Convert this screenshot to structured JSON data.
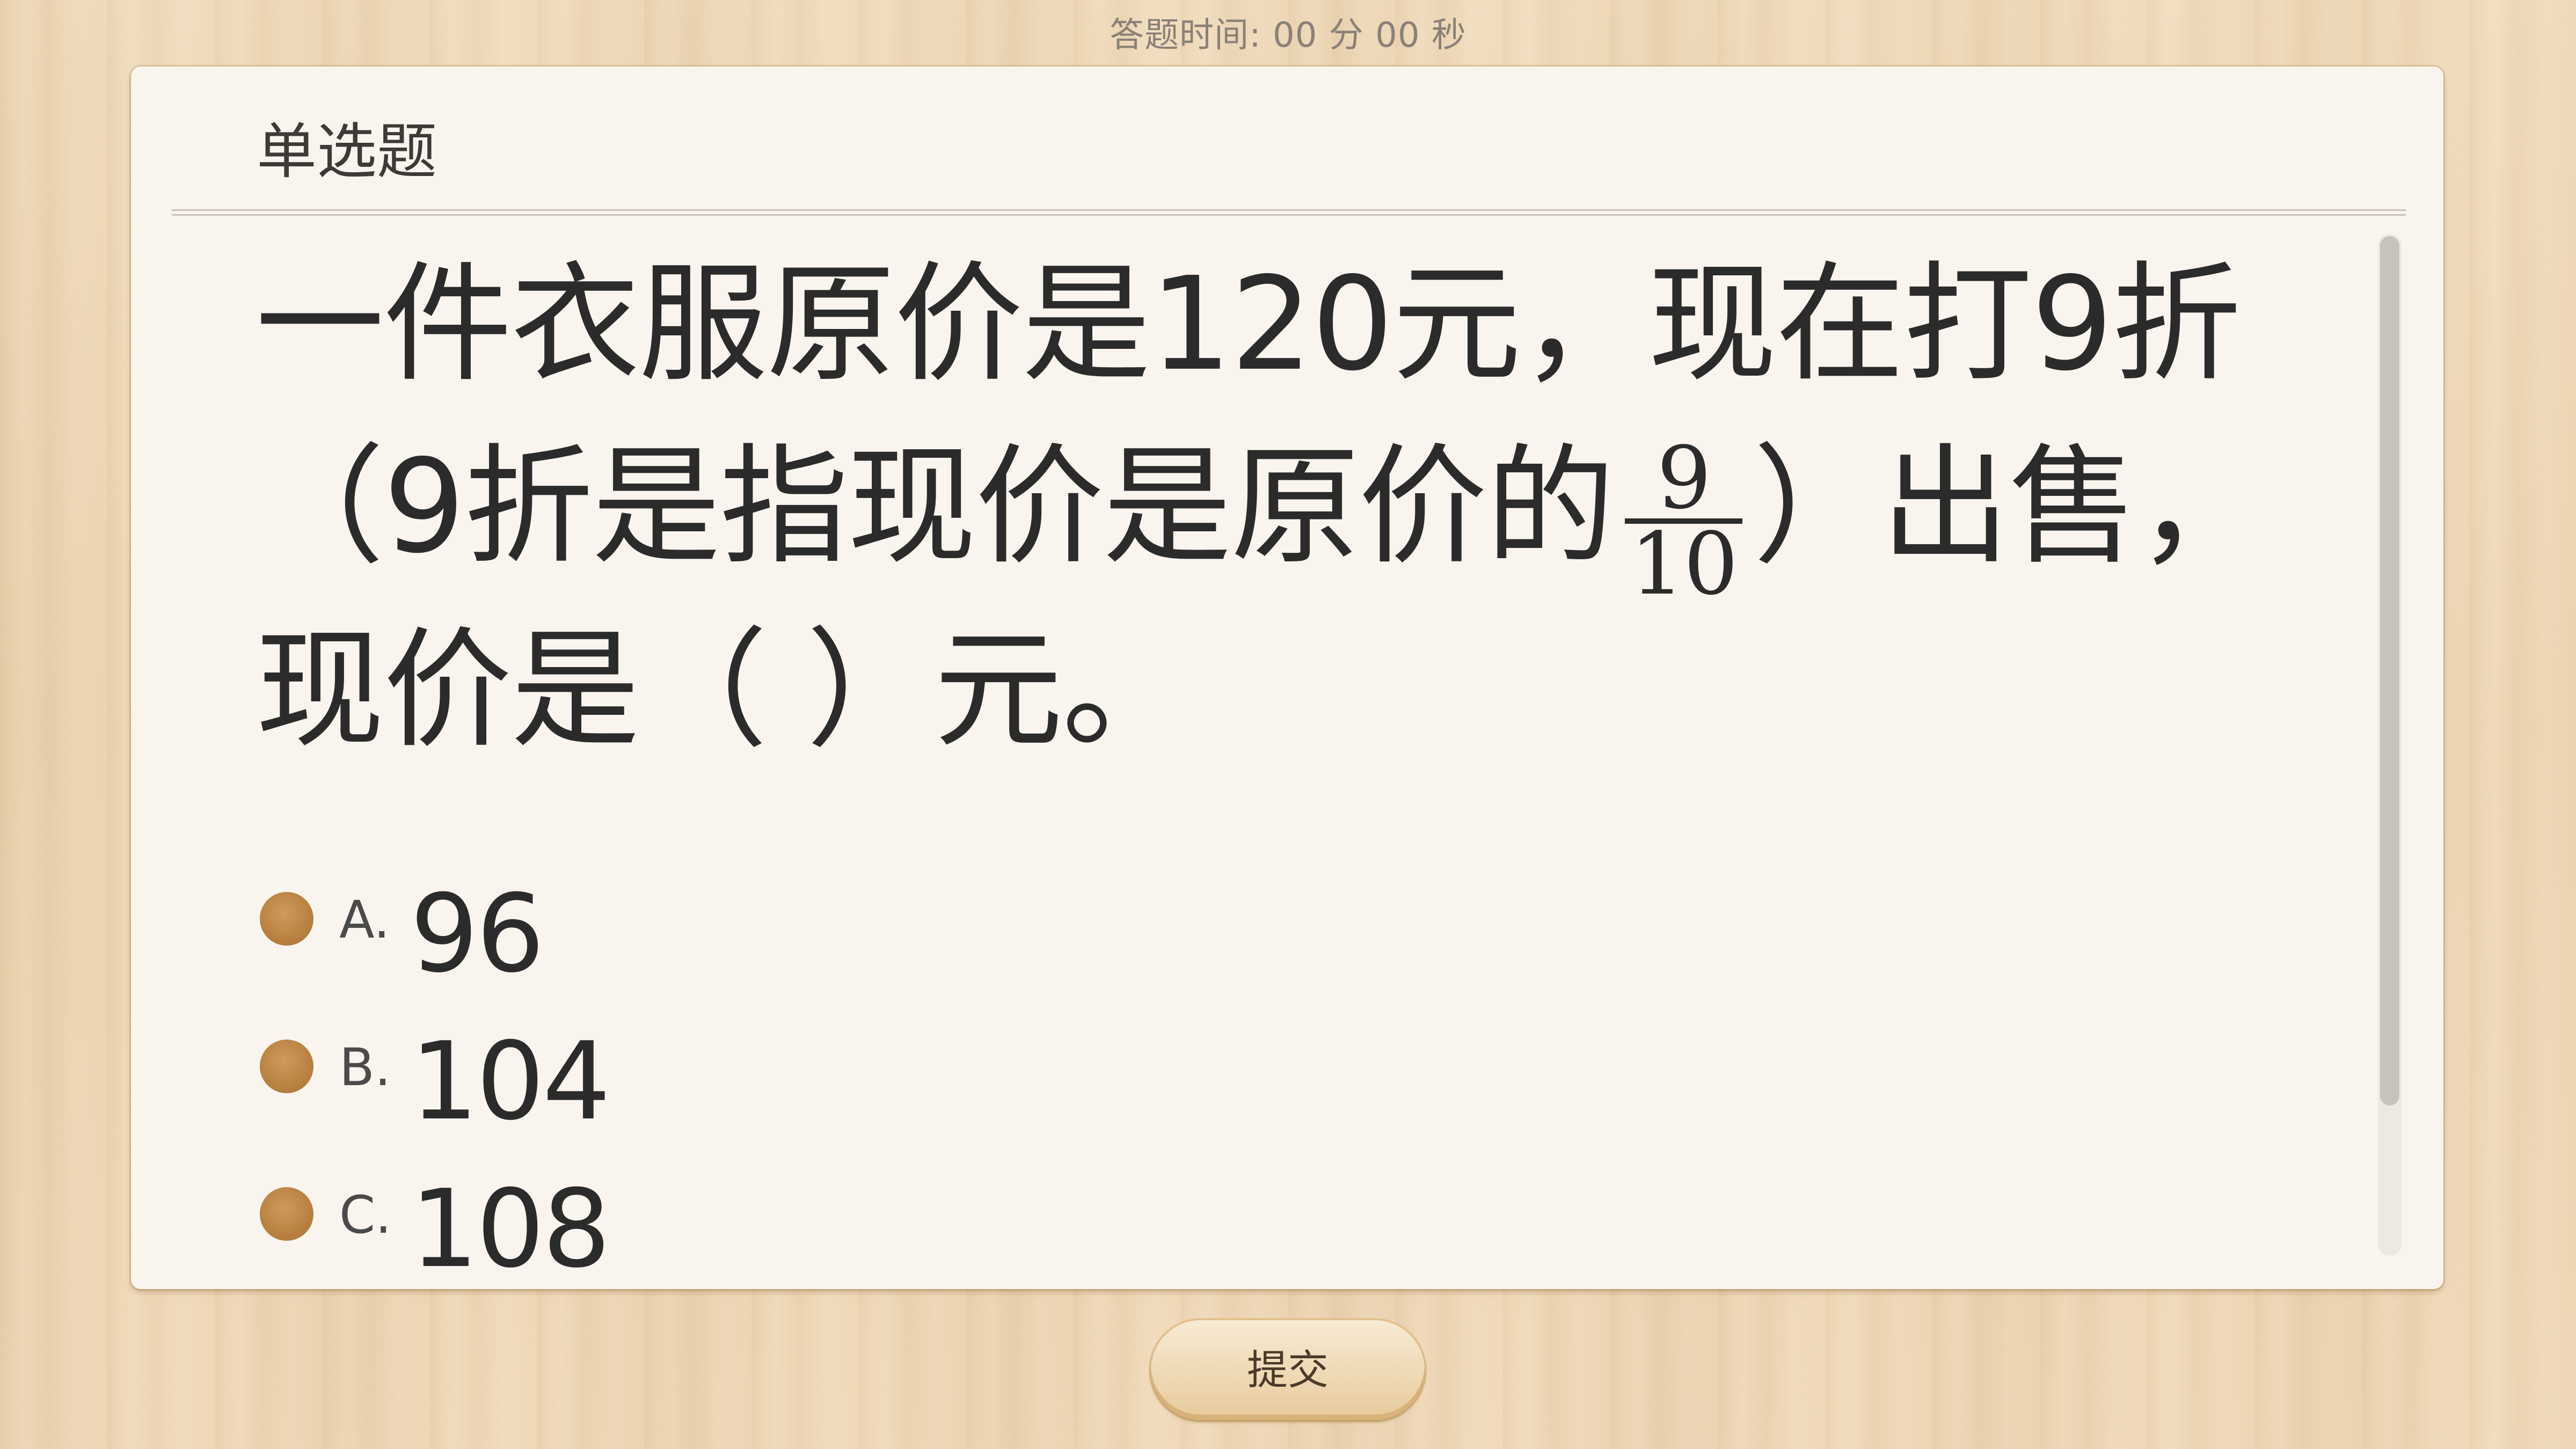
{
  "timer": {
    "label": "答题时间:",
    "value": "00 分 00 秒"
  },
  "card": {
    "question_type": "单选题",
    "question": {
      "part1": "一件衣服原价是120元，现在打9折（9折是指现价是原价的",
      "fraction_numerator": "9",
      "fraction_denominator": "10",
      "part2": "）出售，现价是（    ）元。"
    },
    "options": [
      {
        "letter": "A.",
        "value": "96"
      },
      {
        "letter": "B.",
        "value": "104"
      },
      {
        "letter": "C.",
        "value": "108"
      }
    ]
  },
  "submit_label": "提交",
  "colors": {
    "radio": "#b8813f",
    "card_background": "#f9f5ee",
    "wood_background": "#eed7b5",
    "text": "#2b2b2b"
  }
}
